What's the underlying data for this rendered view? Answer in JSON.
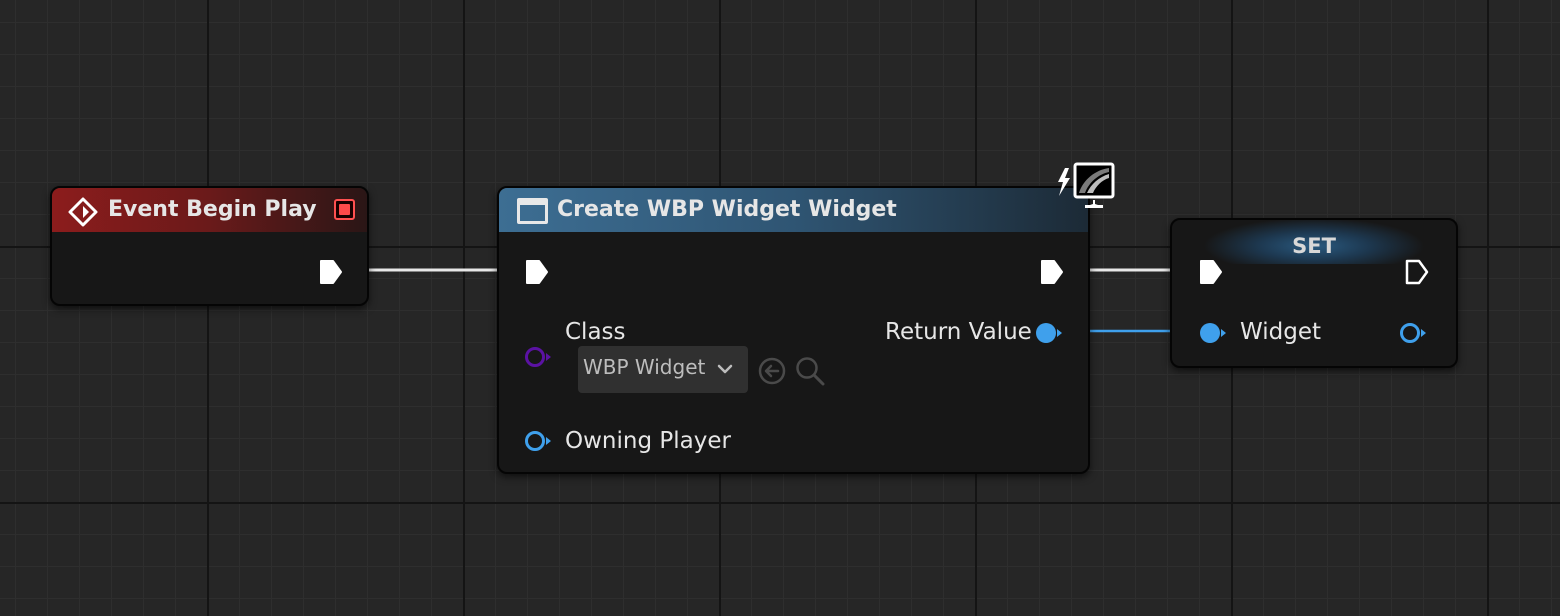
{
  "colors": {
    "exec_wire": "#e8e8e8",
    "object_pin": "#3fa0ec",
    "class_pin": "#5b12a3",
    "event_header": "#8c1c1c",
    "function_header": "#3d6e93",
    "delegate_pin": "#ff4a4a"
  },
  "nodes": {
    "event_begin_play": {
      "title": "Event Begin Play",
      "icon": "event-diamond-icon"
    },
    "create_widget": {
      "title": "Create WBP Widget Widget",
      "icon": "widget-window-icon",
      "badge_icon": "client-only-monitor-icon",
      "pins": {
        "class_label": "Class",
        "class_value": "WBP Widget",
        "owning_player_label": "Owning Player",
        "return_value_label": "Return Value"
      }
    },
    "set_variable": {
      "title": "SET",
      "pins": {
        "widget_label": "Widget"
      }
    }
  }
}
